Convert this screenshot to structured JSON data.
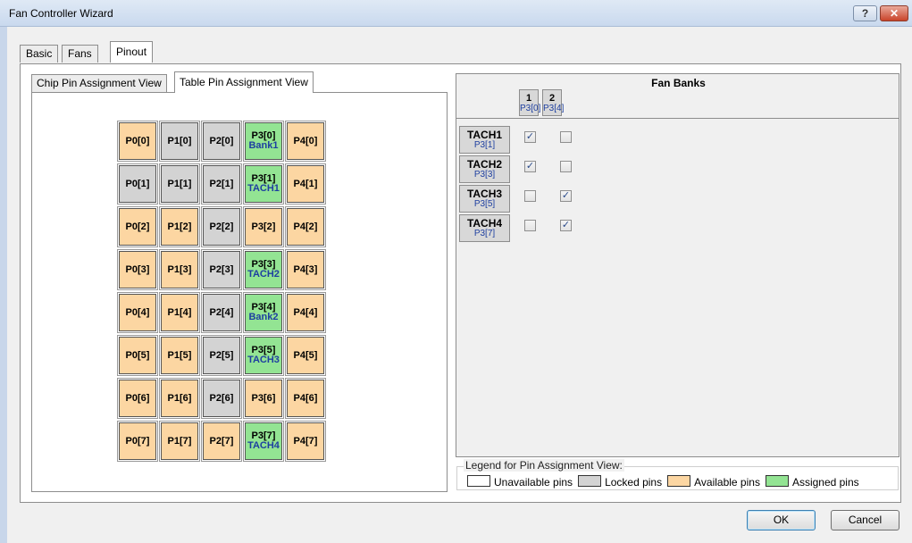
{
  "window": {
    "title": "Fan Controller Wizard",
    "help_label": "?",
    "close_label": "✕"
  },
  "tabs": [
    "Basic",
    "Fans",
    "Pinout"
  ],
  "inner_tabs": [
    "Chip Pin Assignment View",
    "Table Pin Assignment View"
  ],
  "pin_grid": [
    [
      {
        "label": "P0[0]",
        "state": "available"
      },
      {
        "label": "P1[0]",
        "state": "locked"
      },
      {
        "label": "P2[0]",
        "state": "locked"
      },
      {
        "label": "P3[0]",
        "sub": "Bank1",
        "state": "assigned"
      },
      {
        "label": "P4[0]",
        "state": "available"
      }
    ],
    [
      {
        "label": "P0[1]",
        "state": "locked"
      },
      {
        "label": "P1[1]",
        "state": "locked"
      },
      {
        "label": "P2[1]",
        "state": "locked"
      },
      {
        "label": "P3[1]",
        "sub": "TACH1",
        "state": "assigned"
      },
      {
        "label": "P4[1]",
        "state": "available"
      }
    ],
    [
      {
        "label": "P0[2]",
        "state": "available"
      },
      {
        "label": "P1[2]",
        "state": "available"
      },
      {
        "label": "P2[2]",
        "state": "locked"
      },
      {
        "label": "P3[2]",
        "state": "available"
      },
      {
        "label": "P4[2]",
        "state": "available"
      }
    ],
    [
      {
        "label": "P0[3]",
        "state": "available"
      },
      {
        "label": "P1[3]",
        "state": "available"
      },
      {
        "label": "P2[3]",
        "state": "locked"
      },
      {
        "label": "P3[3]",
        "sub": "TACH2",
        "state": "assigned"
      },
      {
        "label": "P4[3]",
        "state": "available"
      }
    ],
    [
      {
        "label": "P0[4]",
        "state": "available"
      },
      {
        "label": "P1[4]",
        "state": "available"
      },
      {
        "label": "P2[4]",
        "state": "locked"
      },
      {
        "label": "P3[4]",
        "sub": "Bank2",
        "state": "assigned"
      },
      {
        "label": "P4[4]",
        "state": "available"
      }
    ],
    [
      {
        "label": "P0[5]",
        "state": "available"
      },
      {
        "label": "P1[5]",
        "state": "available"
      },
      {
        "label": "P2[5]",
        "state": "locked"
      },
      {
        "label": "P3[5]",
        "sub": "TACH3",
        "state": "assigned"
      },
      {
        "label": "P4[5]",
        "state": "available"
      }
    ],
    [
      {
        "label": "P0[6]",
        "state": "available"
      },
      {
        "label": "P1[6]",
        "state": "available"
      },
      {
        "label": "P2[6]",
        "state": "locked"
      },
      {
        "label": "P3[6]",
        "state": "available"
      },
      {
        "label": "P4[6]",
        "state": "available"
      }
    ],
    [
      {
        "label": "P0[7]",
        "state": "available"
      },
      {
        "label": "P1[7]",
        "state": "available"
      },
      {
        "label": "P2[7]",
        "state": "available"
      },
      {
        "label": "P3[7]",
        "sub": "TACH4",
        "state": "assigned"
      },
      {
        "label": "P4[7]",
        "state": "available"
      }
    ]
  ],
  "fan_banks": {
    "title": "Fan Banks",
    "banks": [
      {
        "num": "1",
        "pin": "P3[0]"
      },
      {
        "num": "2",
        "pin": "P3[4]"
      }
    ],
    "tachs": [
      {
        "name": "TACH1",
        "pin": "P3[1]",
        "checks": [
          true,
          false
        ]
      },
      {
        "name": "TACH2",
        "pin": "P3[3]",
        "checks": [
          true,
          false
        ]
      },
      {
        "name": "TACH3",
        "pin": "P3[5]",
        "checks": [
          false,
          true
        ]
      },
      {
        "name": "TACH4",
        "pin": "P3[7]",
        "checks": [
          false,
          true
        ]
      }
    ]
  },
  "legend": {
    "title": "Legend for Pin Assignment View:",
    "items": [
      {
        "label": "Unavailable pins",
        "color": "#ffffff"
      },
      {
        "label": "Locked pins",
        "color": "#d3d3d3"
      },
      {
        "label": "Available pins",
        "color": "#fcd6a2"
      },
      {
        "label": "Assigned pins",
        "color": "#93e493"
      }
    ]
  },
  "buttons": {
    "ok": "OK",
    "cancel": "Cancel"
  },
  "check_glyph": "✓"
}
